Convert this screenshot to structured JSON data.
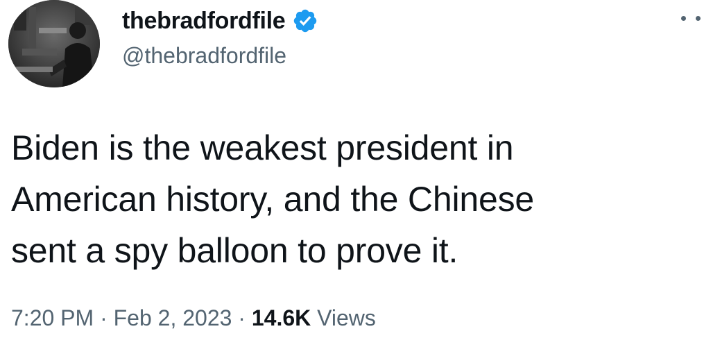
{
  "author": {
    "display_name": "thebradfordfile",
    "handle": "@thebradfordfile",
    "verified": true,
    "verified_color": "#1d9bf0",
    "avatar_icon": "profile-photo"
  },
  "tweet": {
    "text_lines": [
      "Biden is the weakest president in",
      "American history, and the Chinese",
      "sent a spy balloon to prove it."
    ]
  },
  "meta": {
    "time": "7:20 PM",
    "separator": "·",
    "date": "Feb 2, 2023",
    "views_count": "14.6K",
    "views_label": "Views"
  },
  "colors": {
    "primary_text": "#0f1419",
    "secondary_text": "#536471",
    "background": "#ffffff"
  }
}
